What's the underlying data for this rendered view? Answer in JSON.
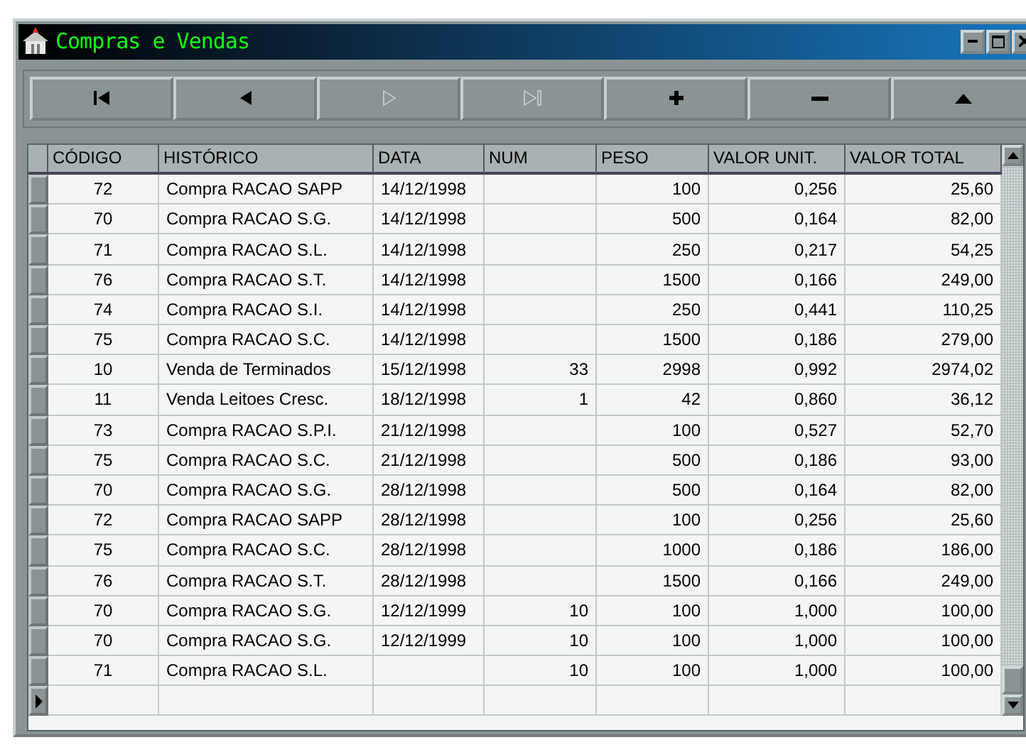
{
  "window": {
    "title": "Compras e Vendas",
    "controls": [
      {
        "kind": "minimize"
      },
      {
        "kind": "maximize"
      },
      {
        "kind": "close"
      }
    ]
  },
  "navigator": [
    {
      "kind": "first",
      "disabled": false
    },
    {
      "kind": "prior",
      "disabled": false
    },
    {
      "kind": "next",
      "disabled": true
    },
    {
      "kind": "last",
      "disabled": true
    },
    {
      "kind": "insert",
      "disabled": false
    },
    {
      "kind": "delete",
      "disabled": false
    },
    {
      "kind": "edit",
      "disabled": false
    }
  ],
  "table": {
    "columns": [
      {
        "label": "CÓDIGO"
      },
      {
        "label": "HISTÓRICO"
      },
      {
        "label": "DATA"
      },
      {
        "label": "NUM"
      },
      {
        "label": "PESO"
      },
      {
        "label": "VALOR UNIT."
      },
      {
        "label": "VALOR TOTAL"
      }
    ],
    "rows": [
      {
        "current": false,
        "cells": [
          "72",
          "Compra RACAO SAPP",
          "14/12/1998",
          "",
          "100",
          "0,256",
          "25,60"
        ]
      },
      {
        "current": false,
        "cells": [
          "70",
          "Compra RACAO S.G.",
          "14/12/1998",
          "",
          "500",
          "0,164",
          "82,00"
        ]
      },
      {
        "current": false,
        "cells": [
          "71",
          "Compra RACAO S.L.",
          "14/12/1998",
          "",
          "250",
          "0,217",
          "54,25"
        ]
      },
      {
        "current": false,
        "cells": [
          "76",
          "Compra RACAO S.T.",
          "14/12/1998",
          "",
          "1500",
          "0,166",
          "249,00"
        ]
      },
      {
        "current": false,
        "cells": [
          "74",
          "Compra RACAO S.I.",
          "14/12/1998",
          "",
          "250",
          "0,441",
          "110,25"
        ]
      },
      {
        "current": false,
        "cells": [
          "75",
          "Compra RACAO S.C.",
          "14/12/1998",
          "",
          "1500",
          "0,186",
          "279,00"
        ]
      },
      {
        "current": false,
        "cells": [
          "10",
          "Venda de Terminados",
          "15/12/1998",
          "33",
          "2998",
          "0,992",
          "2974,02"
        ]
      },
      {
        "current": false,
        "cells": [
          "11",
          "Venda Leitoes Cresc.",
          "18/12/1998",
          "1",
          "42",
          "0,860",
          "36,12"
        ]
      },
      {
        "current": false,
        "cells": [
          "73",
          "Compra RACAO S.P.I.",
          "21/12/1998",
          "",
          "100",
          "0,527",
          "52,70"
        ]
      },
      {
        "current": false,
        "cells": [
          "75",
          "Compra RACAO S.C.",
          "21/12/1998",
          "",
          "500",
          "0,186",
          "93,00"
        ]
      },
      {
        "current": false,
        "cells": [
          "70",
          "Compra RACAO S.G.",
          "28/12/1998",
          "",
          "500",
          "0,164",
          "82,00"
        ]
      },
      {
        "current": false,
        "cells": [
          "72",
          "Compra RACAO SAPP",
          "28/12/1998",
          "",
          "100",
          "0,256",
          "25,60"
        ]
      },
      {
        "current": false,
        "cells": [
          "75",
          "Compra RACAO S.C.",
          "28/12/1998",
          "",
          "1000",
          "0,186",
          "186,00"
        ]
      },
      {
        "current": false,
        "cells": [
          "76",
          "Compra RACAO S.T.",
          "28/12/1998",
          "",
          "1500",
          "0,166",
          "249,00"
        ]
      },
      {
        "current": false,
        "cells": [
          "70",
          "Compra RACAO S.G.",
          "12/12/1999",
          "10",
          "100",
          "1,000",
          "100,00"
        ]
      },
      {
        "current": false,
        "cells": [
          "70",
          "Compra RACAO S.G.",
          "12/12/1999",
          "10",
          "100",
          "1,000",
          "100,00"
        ]
      },
      {
        "current": false,
        "cells": [
          "71",
          "Compra RACAO S.L.",
          "",
          "10",
          "100",
          "1,000",
          "100,00"
        ]
      },
      {
        "current": true,
        "cells": [
          "",
          "",
          "",
          "",
          "",
          "",
          ""
        ]
      }
    ]
  }
}
